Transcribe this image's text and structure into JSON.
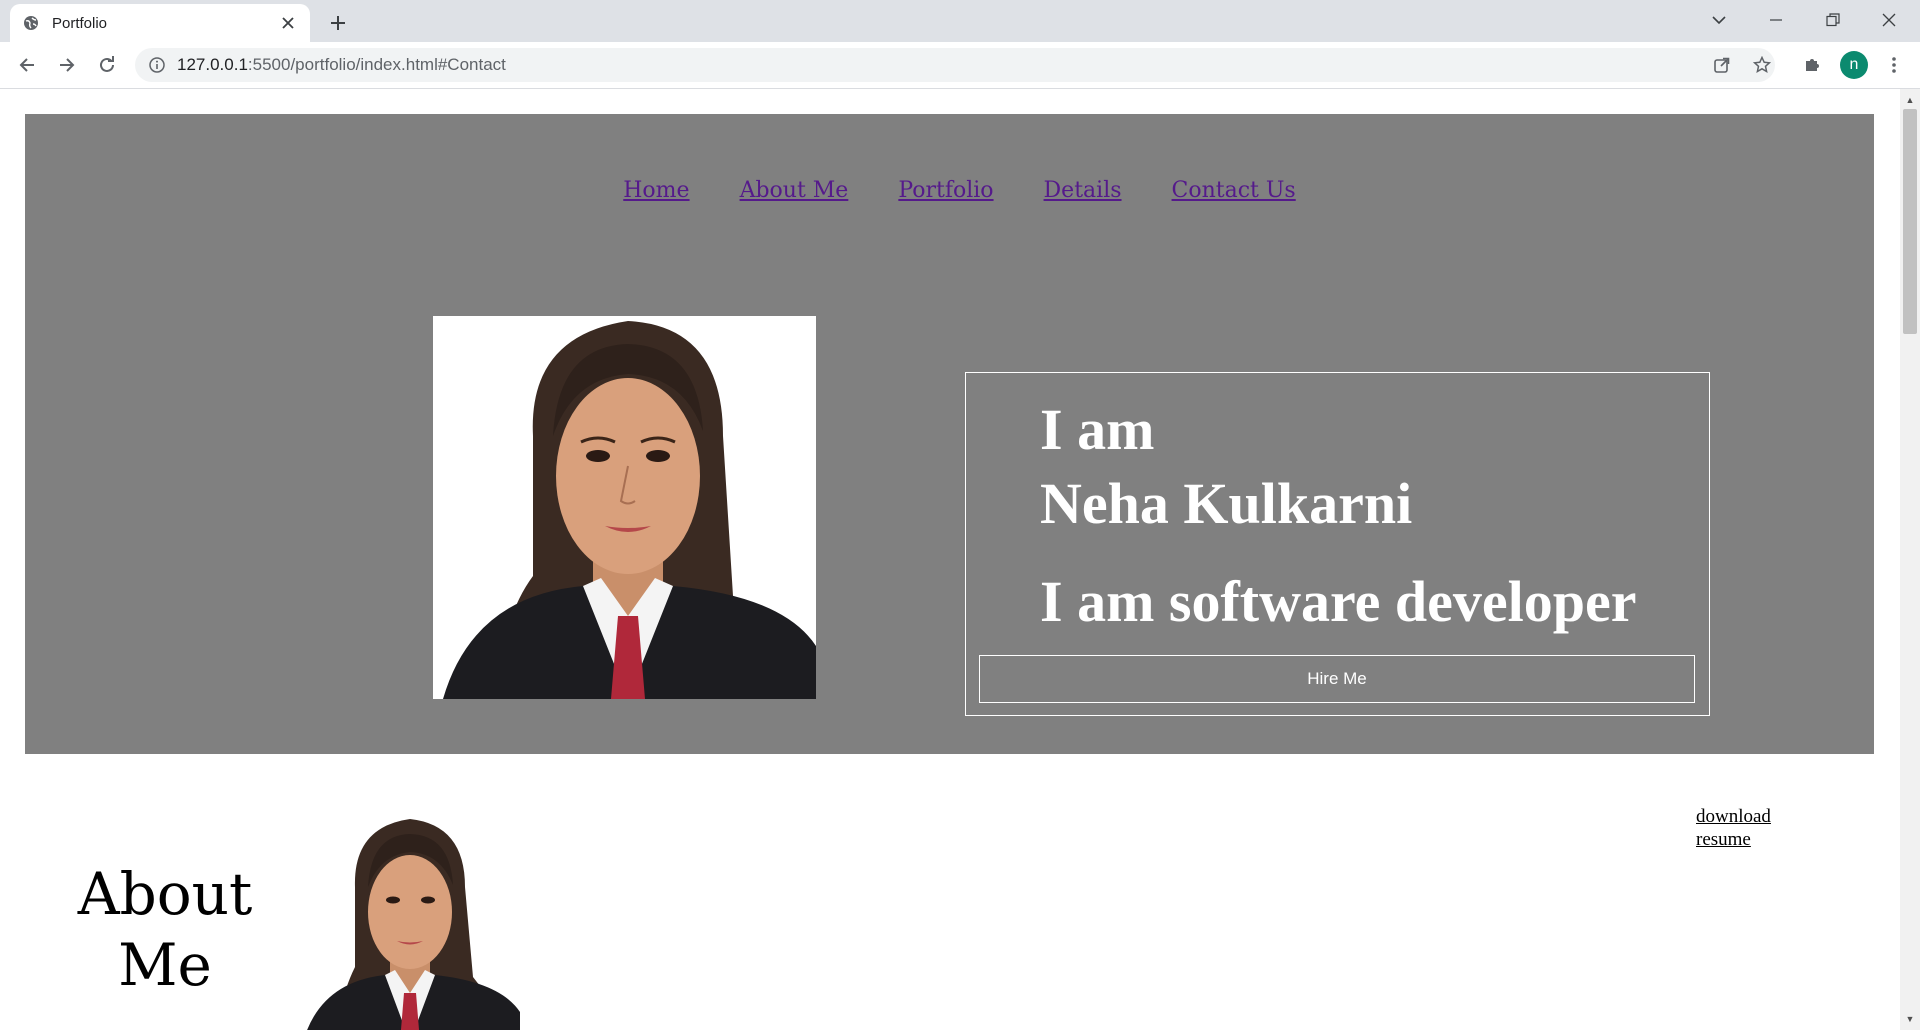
{
  "browser": {
    "tab_title": "Portfolio",
    "url_host": "127.0.0.1",
    "url_path": ":5500/portfolio/index.html#Contact",
    "profile_initial": "n"
  },
  "nav": {
    "items": [
      "Home",
      "About Me",
      "Portfolio",
      "Details",
      "Contact Us"
    ]
  },
  "hero": {
    "line1": "I am",
    "line2": "Neha Kulkarni",
    "line3": "I am software developer",
    "hire_label": "Hire Me"
  },
  "about": {
    "title_line1": "About",
    "title_line2": "Me",
    "download_line1": "download",
    "download_line2": "resume"
  },
  "colors": {
    "hero_bg": "#808080",
    "nav_link": "#551a8b",
    "avatar": "#0b8a6f"
  },
  "icons": [
    "globe-icon",
    "close-icon",
    "plus-icon",
    "chevron-down-icon",
    "minimize-icon",
    "restore-icon",
    "back-arrow-icon",
    "forward-arrow-icon",
    "reload-icon",
    "info-icon",
    "share-icon",
    "star-icon",
    "puzzle-icon",
    "more-vert-icon"
  ]
}
